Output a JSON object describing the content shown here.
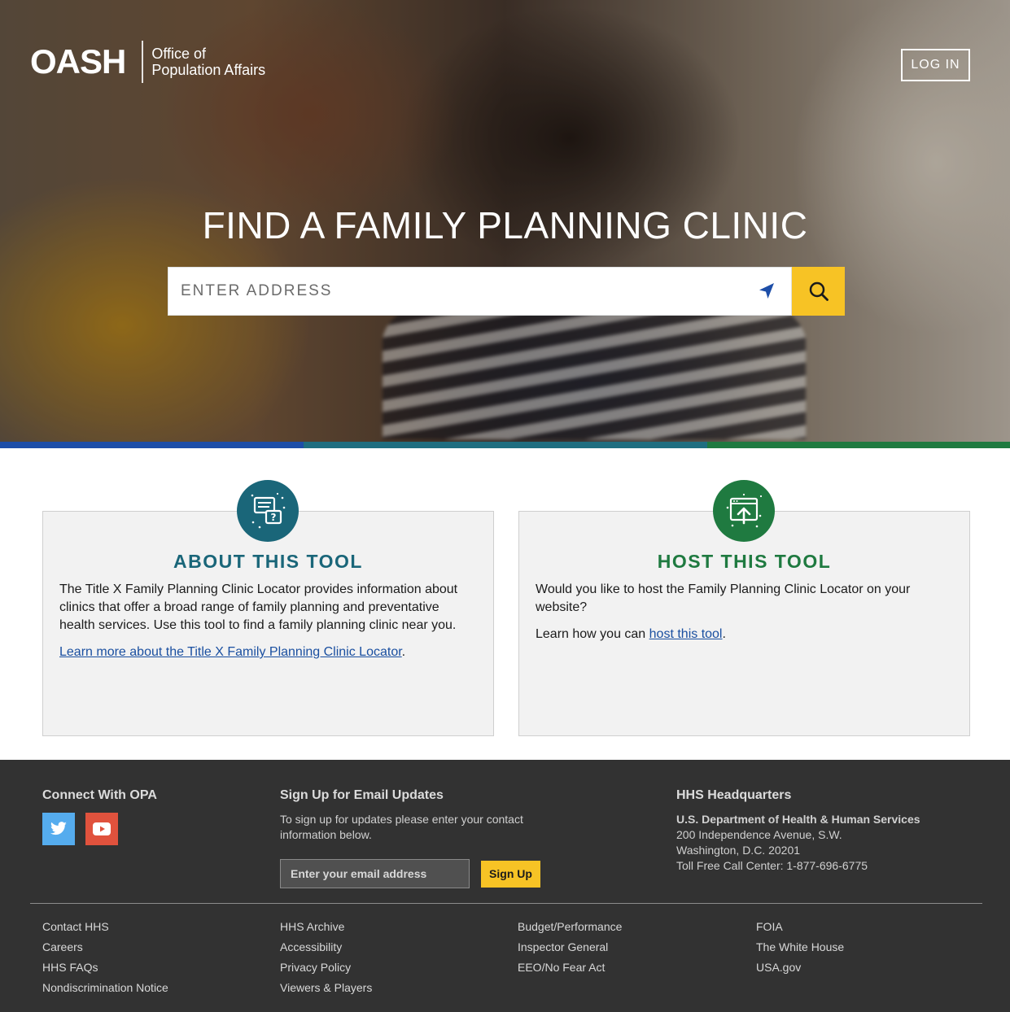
{
  "brand": {
    "mark": "OASH",
    "name_line1": "Office of",
    "name_line2": "Population Affairs"
  },
  "header": {
    "login_label": "LOG IN"
  },
  "hero": {
    "title": "FIND A FAMILY PLANNING CLINIC",
    "search_placeholder": "ENTER ADDRESS"
  },
  "about": {
    "title": "ABOUT THIS TOOL",
    "body": "The Title X Family Planning Clinic Locator provides information about clinics that offer a broad range of family planning and preventative health services. Use this tool to find a family planning clinic near you.",
    "link": "Learn more about the Title X Family Planning Clinic Locator",
    "link_suffix": "."
  },
  "host": {
    "title": "HOST THIS TOOL",
    "body": "Would you like to host the Family Planning Clinic Locator on your website?",
    "learn_prefix": "Learn how you can ",
    "link": "host this tool",
    "link_suffix": "."
  },
  "footer": {
    "connect": {
      "heading": "Connect With OPA"
    },
    "email": {
      "heading": "Sign Up for Email Updates",
      "description": "To sign up for updates please enter your contact information below.",
      "placeholder": "Enter your email address",
      "button": "Sign Up"
    },
    "hq": {
      "heading": "HHS Headquarters",
      "org": "U.S. Department of Health & Human Services",
      "address1": "200 Independence Avenue, S.W.",
      "address2": "Washington, D.C. 20201",
      "phone": "Toll Free Call Center: 1-877-696-6775"
    },
    "links": [
      [
        "Contact HHS",
        "Careers",
        "HHS FAQs",
        "Nondiscrimination Notice"
      ],
      [
        "HHS Archive",
        "Accessibility",
        "Privacy Policy",
        "Viewers & Players"
      ],
      [
        "Budget/Performance",
        "Inspector General",
        "EEO/No Fear Act"
      ],
      [
        "FOIA",
        "The White House",
        "USA.gov"
      ]
    ]
  },
  "colors": {
    "accent_yellow": "#f7c325",
    "teal": "#1a6679",
    "green": "#1f7a40",
    "blue": "#1d4ea8",
    "footer_bg": "#323232"
  }
}
